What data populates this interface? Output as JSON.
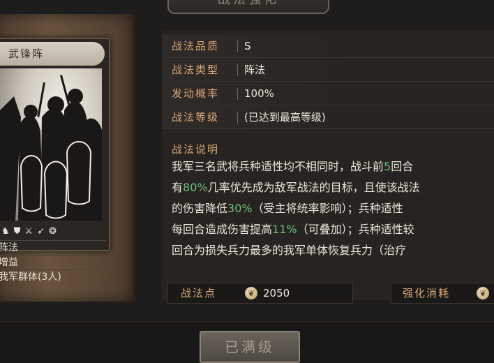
{
  "header": {
    "title": "战法强化"
  },
  "card": {
    "name": "武锋阵",
    "icons": [
      "horse-icon",
      "shield-icon",
      "crossbow-icon",
      "spear-icon",
      "wheel-icon"
    ],
    "lines": [
      "阵法",
      "增益",
      "我军群体(3人)"
    ]
  },
  "info": {
    "quality_label": "战法品质",
    "quality_value": "S",
    "type_label": "战法类型",
    "type_value": "阵法",
    "rate_label": "发动概率",
    "rate_value": "100%",
    "level_label": "战法等级",
    "level_value": "(已达到最高等级)"
  },
  "description": {
    "label": "战法说明",
    "line1_a": "我军三名武将兵种适性均不相同时，战斗前",
    "line1_b": "5",
    "line1_c": "回合",
    "line2_a": "有",
    "line2_b": "80%",
    "line2_c": "几率优先成为敌军战法的目标，且使该战法",
    "line3_a": "的伤害降低",
    "line3_b": "30%",
    "line3_c": "（受主将统率影响）；兵种适性",
    "line4_a": "每回合造成伤害提高",
    "line4_b": "11%",
    "line4_c": "（可叠加）；兵种适性较",
    "line5": "回合为损失兵力最多的我军单体恢复兵力（治疗"
  },
  "points": {
    "label": "战法点",
    "value": "2050"
  },
  "cost": {
    "label": "强化消耗"
  },
  "button": {
    "label": "已满级"
  },
  "colors": {
    "label_gold": "#d9a776",
    "highlight_green": "#6fbf7e"
  }
}
